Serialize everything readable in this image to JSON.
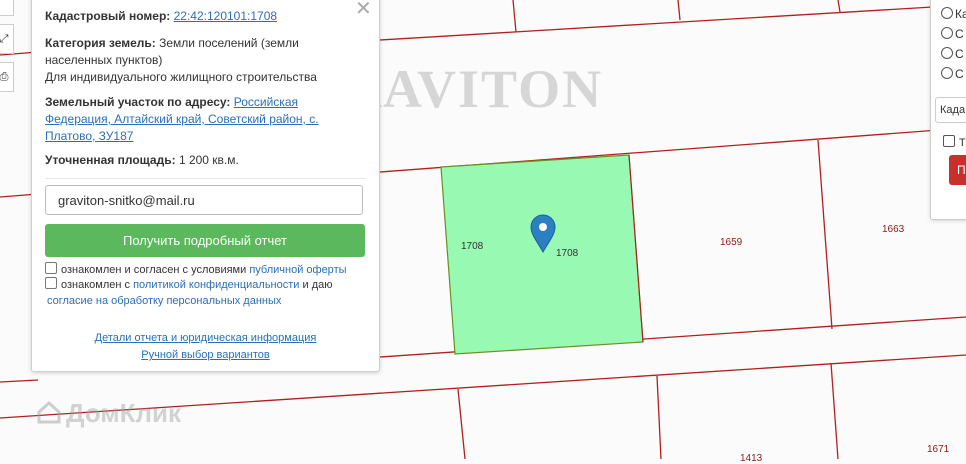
{
  "popup": {
    "cadastral_label": "Кадастровый номер:",
    "cadastral_value": "22:42:120101:1708",
    "category_label": "Категория земель:",
    "category_value_1": "Земли поселений (земли",
    "category_value_2": "населенных пунктов)",
    "category_value_3": "Для индивидуального жилищного строительства",
    "address_label": "Земельный участок по адресу:",
    "address_value_1": "Российская",
    "address_value_2": "Федерация, Алтайский край, Советский район, с.",
    "address_value_3": "Платово, ЗУ187",
    "area_label": "Уточненная площадь:",
    "area_value": "1 200 кв.м.",
    "email_value": "graviton-snitko@mail.ru",
    "report_button": "Получить подробный отчет",
    "consent1_text": "ознакомлен и согласен с условиями",
    "consent1_link": "публичной оферты",
    "consent2_text": "ознакомлен с",
    "consent2_link": "политикой конфиденциальности",
    "consent2_and": "и даю",
    "consent2_link2": "согласие на обработку персональных данных",
    "details_link": "Детали отчета и юридическая информация",
    "manual_link": "Ручной выбор вариантов",
    "close_glyph": "✕"
  },
  "map": {
    "watermark": "GRAVITON",
    "domclick": "ДомКлик",
    "labels": {
      "plot_1708_left": "1708",
      "plot_1708_center": "1708",
      "plot_1659": "1659",
      "plot_1663": "1663",
      "plot_1671": "1671",
      "plot_1413": "1413"
    },
    "selected_fill": "#98f9b2",
    "boundary_color": "#b21f1f",
    "marker_color": "#2b7fc3"
  },
  "right_panel": {
    "radio_1": "Ка",
    "radio_2": "С",
    "radio_3": "С",
    "radio_4": "С",
    "input_value": "Када",
    "checkbox_label": "Т",
    "button_label": "П"
  },
  "tools": {
    "expand_icon": "⤢",
    "print_icon": "⎙"
  }
}
